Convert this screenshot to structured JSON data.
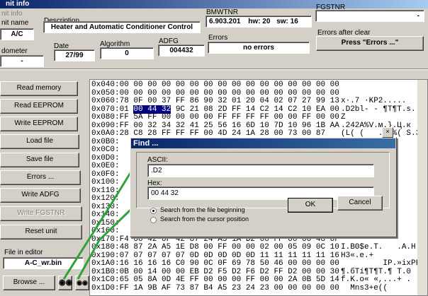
{
  "window": {
    "title": "nit info"
  },
  "header": {
    "unit_info_label": "nit info",
    "unit_name_label": "nit name",
    "unit_name_value": "A/C",
    "description_label": "Description",
    "description_value": "Heater and Automatic Conditioner Control",
    "bmwtnr_label": "BMWTNR",
    "bmwtnr_value": "6.903.201",
    "hw_value": "hw: 20",
    "sw_value": "sw: 16",
    "fgstnr_label": "FGSTNR",
    "fgstnr_value": "-",
    "odometer_label": "dometer",
    "odometer_value": "-",
    "date_label": "Date",
    "date_value": "27/99",
    "algorithm_label": "Algorithm",
    "algorithm_value": "0",
    "adfg_label": "ADFG",
    "adfg_value": "004432",
    "errors_label": "Errors",
    "errors_value": "no errors",
    "errors_after_clear_label": "Errors after clear",
    "errors_after_clear_value": "Press \"Errors ...\""
  },
  "sidebar": {
    "buttons": [
      {
        "label": "Read memory"
      },
      {
        "label": "Read EEPROM"
      },
      {
        "label": "Write EEPROM"
      },
      {
        "label": "Load file"
      },
      {
        "label": "Save file"
      },
      {
        "label": "Errors ..."
      },
      {
        "label": "Write ADFG"
      },
      {
        "label": "Write FGSTNR"
      },
      {
        "label": "Reset unit"
      }
    ],
    "file_in_editor_label": "File in editor",
    "file_in_editor_value": "A-C_wr.bin",
    "browse_label": "Browse ..."
  },
  "hex": {
    "lines": [
      "0x040:00 00 00 00 00 00 00 00 00 00 00 00 00 00 00 00",
      "0x050:00 00 00 00 00 00 00 00 00 00 00 00 00 00 00 00",
      "0x060:78 0F 00 37 FF 86 90 32 01 20 04 02 07 27 99 13",
      "0x070:01 ",
      "0x080:FF 5A FF 00 00 00 00 FF FF FF FF 00 00 FF 00 00",
      "0x090:FF 00 32 34 32 41 25 56 16 6D 10 7D 10 96 1B AA",
      "0x0A0:28 C8 28 FF FF FF 00 4D 24 1A 28 00 73 00 87",
      "0x0B0:",
      "0x0C0:",
      "0x0D0:",
      "0x0E0:",
      "0x0F0:",
      "0x100:",
      "0x110:",
      "0x120:",
      "0x130:",
      "0x140:",
      "0x150:",
      "0x160:",
      "0x170:F4 00 42 0F 42 87 24 A5 1A D2 00 FF 00 00 48 0F",
      "0x180:48 87 2A A5 1E D8 00 FF 00 00 02 00 05 09 0C 10",
      "0x190:07 07 07 07 07 0D 0D 0D 0D 0D 11 11 11 11 11 16",
      "0x1A0:16 16 16 16 C0 90 0C 0F 69 78 50 46 00 00 00 00",
      "0x1B0:0B 00 14 00 00 EB D2 F5 D2 F6 D2 FF D2 00 00 30",
      "0x1C0:65 05 8A 0D 4E FF 00 00 00 FF 00 00 2A 0B 5D 14",
      "0x1D0:FF 1A 9B AF 73 87 B4 A5 23 24 23 00 00 00 00 00"
    ],
    "selected_bytes": "00 44 32",
    "line_070_rest": " 9C 21 08 2D FF 14 C2 14 C2 10 EA 00",
    "ascii": [
      "",
      "",
      "x·.7 ·KP2.....",
      ".D2bl- - ¶T¶T.s.",
      "Z",
      ".242A%V.м.}.Ц.к",
      "(L( (   ...%( S.3",
      "",
      "",
      "",
      "",
      "",
      "",
      "",
      "",
      "",
      "",
      "",
      "",
      "",
      "I.BΘ$e.T.   .A.H",
      "H3«.e.+",
      "         IP.»ixPF.",
      "¶.бTí¶T¶T.¶ T.0",
      "f.K.o« «,...+ .",
      "  Mns3+e(("
    ]
  },
  "find_dialog": {
    "title": "Find ...",
    "ascii_label": "ASCII:",
    "ascii_value": ".D2",
    "hex_label": "Hex:",
    "hex_value": "00 44 32",
    "option_begin": "Search from the file beginning",
    "option_cursor": "Search from the cursor position",
    "ok_label": "OK",
    "cancel_label": "Cancel",
    "close_glyph": "×"
  }
}
